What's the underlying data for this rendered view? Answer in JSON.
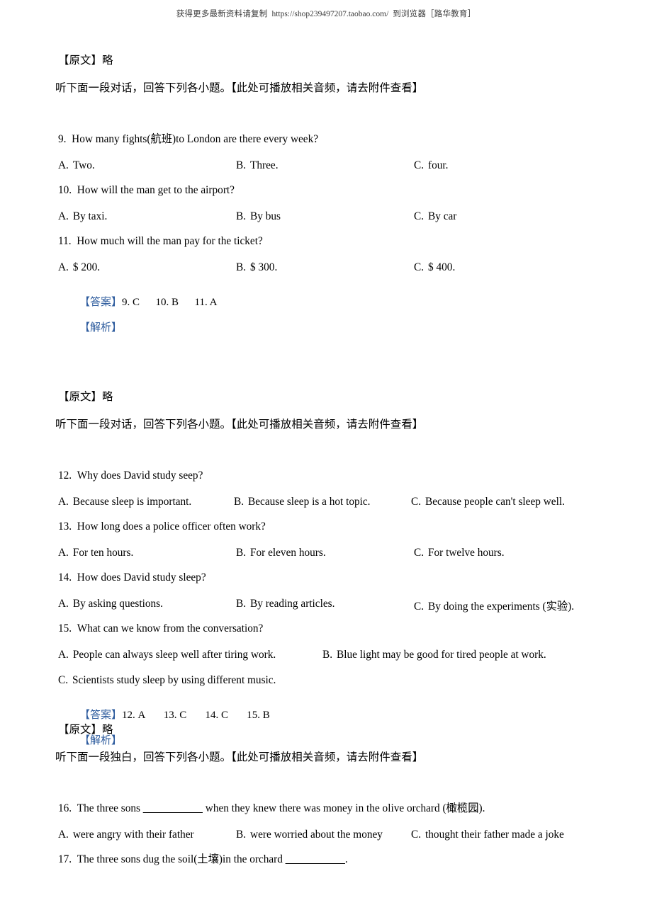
{
  "header": {
    "prefix": "获得更多最新资料请复制",
    "url": "https://shop239497207.taobao.com/",
    "suffix": "到浏览器［路华教育］"
  },
  "sections": [
    {
      "source_label": "【原文】略",
      "instruction": "听下面一段对话，回答下列各小题。【此处可播放相关音频，请去附件查看】",
      "questions": [
        {
          "number": "9.",
          "text": "How many fights(航班)to London are there every week?",
          "layout": "three-col",
          "options": [
            {
              "letter": "A.",
              "text": "Two."
            },
            {
              "letter": "B.",
              "text": "Three."
            },
            {
              "letter": "C.",
              "text": "four."
            }
          ]
        },
        {
          "number": "10.",
          "text": "How will the man get to the airport?",
          "layout": "three-col",
          "options": [
            {
              "letter": "A.",
              "text": "By taxi."
            },
            {
              "letter": "B.",
              "text": "By bus"
            },
            {
              "letter": "C.",
              "text": "By car"
            }
          ]
        },
        {
          "number": "11.",
          "text": "How much will the man pay for the ticket?",
          "layout": "three-col",
          "options": [
            {
              "letter": "A.",
              "text": "$ 200."
            },
            {
              "letter": "B.",
              "text": "$ 300."
            },
            {
              "letter": "C.",
              "text": "$ 400."
            }
          ]
        }
      ],
      "answer_tag": "【答案】",
      "answers": "9. C      10. B      11. A",
      "analysis_tag": "【解析】"
    },
    {
      "source_label": "【原文】略",
      "instruction": "听下面一段对话，回答下列各小题。【此处可播放相关音频，请去附件查看】",
      "questions": [
        {
          "number": "12.",
          "text": "Why does David study seep?",
          "layout": "wide-three",
          "options": [
            {
              "letter": "A.",
              "text": "Because sleep is important."
            },
            {
              "letter": "B.",
              "text": "Because sleep is a hot topic."
            },
            {
              "letter": "C.",
              "text": "Because people can't sleep well."
            }
          ]
        },
        {
          "number": "13.",
          "text": "How long does a police officer often work?",
          "layout": "wide-three",
          "options": [
            {
              "letter": "A.",
              "text": "For ten hours."
            },
            {
              "letter": "B.",
              "text": "For eleven hours."
            },
            {
              "letter": "C.",
              "text": "For twelve hours."
            }
          ]
        },
        {
          "number": "14.",
          "text": "How does David study sleep?",
          "layout": "wide-three",
          "options": [
            {
              "letter": "A.",
              "text": "By asking questions."
            },
            {
              "letter": "B.",
              "text": "By reading articles."
            },
            {
              "letter": "C.",
              "text": "By doing the experiments (实验)."
            }
          ]
        },
        {
          "number": "15.",
          "text": "What can we know from the conversation?",
          "layout": "two-plus-one",
          "options": [
            {
              "letter": "A.",
              "text": "People can always sleep well after tiring work."
            },
            {
              "letter": "B.",
              "text": "Blue light may be good for tired people at work."
            },
            {
              "letter": "C.",
              "text": "Scientists study sleep by using different music."
            }
          ]
        }
      ],
      "answer_tag": "【答案】",
      "answers": "12. A       13. C       14. C       15. B",
      "analysis_tag": "【解析】"
    },
    {
      "source_label": "【原文】略",
      "instruction": "听下面一段独白，回答下列各小题。【此处可播放相关音频，请去附件查看】",
      "questions": [
        {
          "number": "16.",
          "text_before_blank": "The three sons ",
          "blank": "___________",
          "text_after_blank": " when they knew there was money in the olive orchard (橄榄园).",
          "layout": "narrow-three",
          "options": [
            {
              "letter": "A.",
              "text": "were angry with their father"
            },
            {
              "letter": "B.",
              "text": "were worried about the money"
            },
            {
              "letter": "C.",
              "text": "thought their father made a joke"
            }
          ]
        },
        {
          "number": "17.",
          "text_before_blank": "The three sons dug the soil(土壤)in the orchard ",
          "blank": "___________",
          "text_after_blank": ".",
          "layout": "none",
          "options": []
        }
      ]
    }
  ]
}
